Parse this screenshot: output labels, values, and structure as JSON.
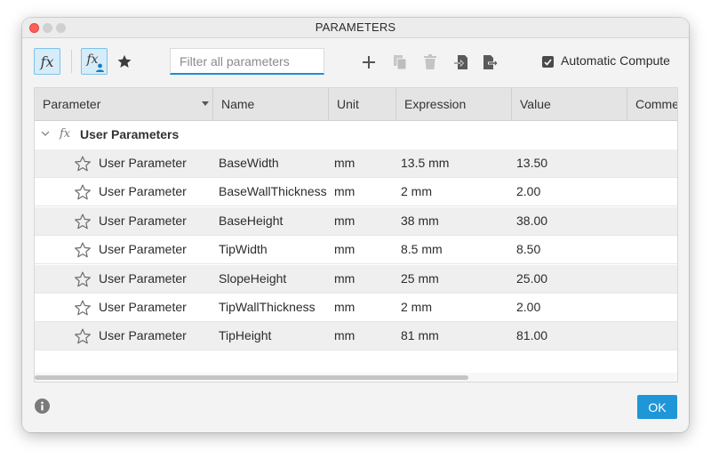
{
  "window": {
    "title": "PARAMETERS"
  },
  "toolbar": {
    "fx_button_glyph": "fx",
    "user_fx_button_glyph": "fx",
    "favorites_icon": "star-icon",
    "filter_placeholder": "Filter all parameters",
    "filter_value": "",
    "icons": [
      "plus-icon",
      "copy-icon",
      "trash-icon",
      "import-icon",
      "export-icon"
    ],
    "automatic_compute_label": "Automatic Compute",
    "automatic_compute_checked": true
  },
  "table": {
    "columns": [
      "Parameter",
      "Name",
      "Unit",
      "Expression",
      "Value",
      "Comment"
    ],
    "group": {
      "glyph": "fx",
      "label": "User Parameters"
    },
    "rows": [
      {
        "parameter": "User Parameter",
        "name": "BaseWidth",
        "unit": "mm",
        "expression": "13.5 mm",
        "value": "13.50"
      },
      {
        "parameter": "User Parameter",
        "name": "BaseWallThickness",
        "unit": "mm",
        "expression": "2 mm",
        "value": "2.00"
      },
      {
        "parameter": "User Parameter",
        "name": "BaseHeight",
        "unit": "mm",
        "expression": "38 mm",
        "value": "38.00"
      },
      {
        "parameter": "User Parameter",
        "name": "TipWidth",
        "unit": "mm",
        "expression": "8.5 mm",
        "value": "8.50"
      },
      {
        "parameter": "User Parameter",
        "name": "SlopeHeight",
        "unit": "mm",
        "expression": "25 mm",
        "value": "25.00"
      },
      {
        "parameter": "User Parameter",
        "name": "TipWallThickness",
        "unit": "mm",
        "expression": "2 mm",
        "value": "2.00"
      },
      {
        "parameter": "User Parameter",
        "name": "TipHeight",
        "unit": "mm",
        "expression": "81 mm",
        "value": "81.00"
      }
    ]
  },
  "footer": {
    "info_icon": "info-icon",
    "ok_label": "OK"
  },
  "colors": {
    "accent": "#1f96d8",
    "active_toggle_bg": "#d6ecf8",
    "close_button": "#ff5f57"
  }
}
